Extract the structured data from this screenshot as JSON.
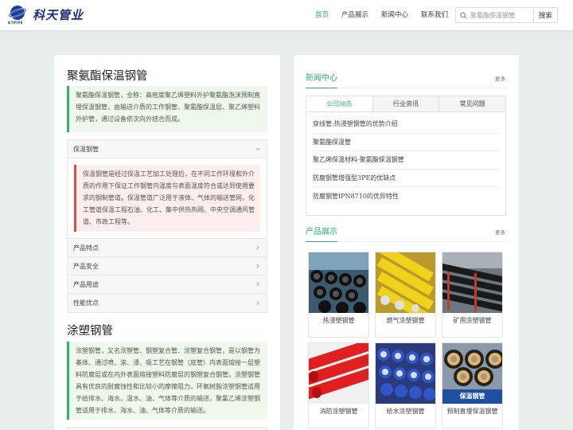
{
  "header": {
    "logo_text": "科天管业",
    "logo_sub": "KTPIPE",
    "nav": [
      "首页",
      "产品展示",
      "新闻中心",
      "联系我们"
    ],
    "search_placeholder": "聚氨酯保温钢管",
    "search_button": "搜索"
  },
  "left": {
    "title1": "聚氨酯保温钢管",
    "intro1": "聚氨酯保温钢管，全称：高密度聚乙烯塑料外护聚氨酯泡沫预制直埋保温钢管，由输送介质的工作钢管、聚氨酯保温层、聚乙烯塑料外护管，通过设备依次向外结合而成。",
    "accordion": {
      "open_label": "保温钢管",
      "open_text": "保温钢管是经过保温工艺加工处理后，在不同工作环境和外介质的作用下保证工作钢管内温度与表面温度符合或达到使用要求的钢制管道。保温管道广泛用于液体、气体的输送管网，化工管道保温工程石油、化工、集中供热热网、中央空调通风管道、市政工程等。",
      "items": [
        "产品特点",
        "产品安全",
        "产品用途",
        "性能优点"
      ]
    },
    "title2": "涂塑钢管",
    "intro2": "涂塑钢管，又名涂塑管、钢塑复合管、涂塑复合钢管，是以钢管为基体、通过喷、滚、浸、吸工艺在钢管（底管）内表面熔接一层塑料防腐层或在内外表面熔接塑料防腐层的钢塑复合钢管。涂塑钢管具有优良的耐腐蚀性和比较小的摩擦阻力。环氧树脂涂塑钢管适用于给排水、海水、温水、油、气体等介质的输送，聚氯乙烯涂塑钢管适用于排水、海水、油、气体等介质的输送。"
  },
  "right": {
    "news_title": "新闻中心",
    "more": "更多",
    "tabs": [
      "公司动态",
      "行业资讯",
      "常见问题"
    ],
    "news": [
      "穿线管:热浸塑钢管的优势介绍",
      "聚氨酯保温管",
      "聚乙烯保温材料-聚氨酯保温钢管",
      "防腐钢管增强型3PE的优缺点",
      "防腐钢管IPN8710的优异特性"
    ],
    "products_title": "产品展示",
    "products": [
      "热浸塑钢管",
      "燃气涂塑钢管",
      "矿用涂塑钢管",
      "消防涂塑钢管",
      "给水涂塑钢管",
      "预制直埋保温钢管"
    ],
    "product_image_text": "保温钢管"
  },
  "colors": {
    "accent": "#2fb36a",
    "red": "#e04a4a",
    "logo": "#1b2f7d"
  }
}
